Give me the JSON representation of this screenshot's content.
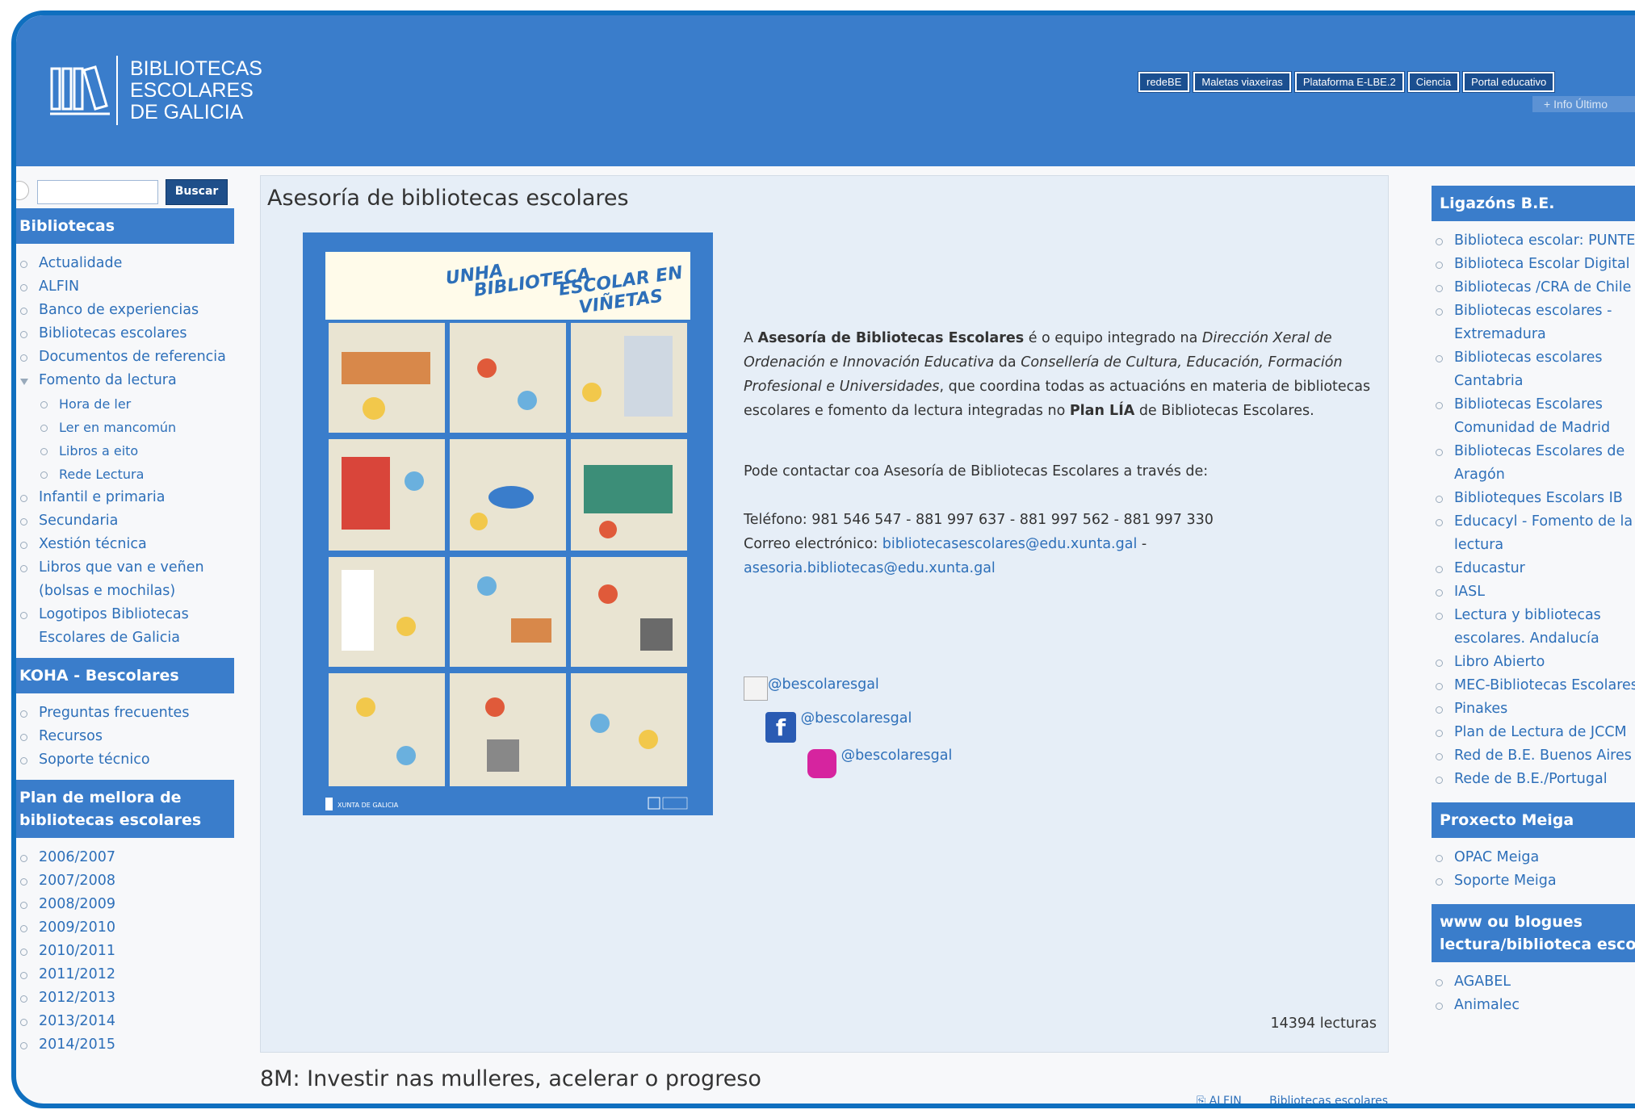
{
  "header": {
    "logo_text_1": "BIBLIOTECAS",
    "logo_text_2": "ESCOLARES",
    "logo_text_3": "DE GALICIA",
    "top_links": [
      "redeBE",
      "Maletas viaxeiras",
      "Plataforma E-LBE.2",
      "Ciencia",
      "Portal educativo"
    ],
    "info_strip": "+ Info   Último"
  },
  "search": {
    "button": "Buscar",
    "placeholder": ""
  },
  "left": {
    "bibliotecas_title": "Bibliotecas",
    "bibliotecas_items": [
      "Actualidade",
      "ALFIN",
      "Banco de experiencias",
      "Bibliotecas escolares",
      "Documentos de referencia"
    ],
    "fomento": "Fomento da lectura",
    "fomento_sub": [
      "Hora de ler",
      "Ler en mancomún",
      "Libros a eito",
      "Rede Lectura"
    ],
    "after_items": [
      "Infantil e primaria",
      "Secundaria",
      "Xestión técnica",
      "Libros que van e veñen (bolsas e mochilas)",
      "Logotipos Bibliotecas Escolares de Galicia"
    ],
    "koha_title": "KOHA - Bescolares",
    "koha_items": [
      "Preguntas frecuentes",
      "Recursos",
      "Soporte técnico"
    ],
    "plan_title": "Plan de mellora de bibliotecas escolares",
    "plan_items": [
      "2006/2007",
      "2007/2008",
      "2008/2009",
      "2009/2010",
      "2010/2011",
      "2011/2012",
      "2012/2013",
      "2013/2014",
      "2014/2015"
    ]
  },
  "content": {
    "title": "Asesoría de bibliotecas escolares",
    "poster_title_1": "UNHA",
    "poster_title_2": "BIBLIOTECA",
    "poster_title_3": "ESCOLAR EN",
    "poster_title_4": "VIÑETAS",
    "poster_footer_left": "XUNTA DE GALICIA",
    "p1_a": "A ",
    "p1_b": "Asesoría de Bibliotecas Escolares",
    "p1_c": " é o equipo integrado na ",
    "p1_d": "Dirección Xeral de Ordenación e Innovación Educativa",
    "p1_e": " da ",
    "p1_f": "Consellería de Cultura, Educación, Formación Profesional e Universidades",
    "p1_g": ", que coordina todas as actuacións en materia de bibliotecas escolares e fomento da lectura integradas no ",
    "p1_h": "Plan LÍA",
    "p1_i": " de Bibliotecas Escolares.",
    "p2": "Pode contactar coa Asesoría de Bibliotecas Escolares a través de:",
    "phone": "Teléfono: 981 546 547 - 881 997 637 - 881 997 562 - 881 997 330",
    "email_label": "Correo electrónico: ",
    "email1": "bibliotecasescolares@edu.xunta.gal",
    "email_sep": " -",
    "email2": "asesoria.bibliotecas@edu.xunta.gal",
    "social_twitter": "@bescolaresgal",
    "social_facebook": "@bescolaresgal",
    "social_instagram": "@bescolaresgal",
    "reads": "14394 lecturas"
  },
  "next": {
    "title": "8M: Investir nas mulleres, acelerar o progreso",
    "tag1": "ALFIN",
    "tag2": "Bibliotecas escolares"
  },
  "right": {
    "ligazons_title": "Ligazóns B.E.",
    "ligazons_items": [
      "Biblioteca escolar: PUNTEDU",
      "Biblioteca Escolar Digital",
      "Bibliotecas /CRA de Chile",
      "Bibliotecas escolares - Extremadura",
      "Bibliotecas escolares Cantabria",
      "Bibliotecas Escolares Comunidad de Madrid",
      "Bibliotecas Escolares de Aragón",
      "Biblioteques Escolars IB",
      "Educacyl - Fomento de la lectura",
      "Educastur",
      "IASL",
      "Lectura y bibliotecas escolares. Andalucía",
      "Libro Abierto",
      "MEC-Bibliotecas Escolares",
      "Pinakes",
      "Plan de Lectura de JCCM",
      "Red de B.E. Buenos Aires",
      "Rede de B.E./Portugal"
    ],
    "meiga_title": "Proxecto Meiga",
    "meiga_items": [
      "OPAC Meiga",
      "Soporte Meiga"
    ],
    "www_title": "www ou blogues lectura/biblioteca escolar",
    "www_items": [
      "AGABEL",
      "Animalec"
    ]
  },
  "colors": {
    "header": "#3a7dcb",
    "block": "#3a7dcb",
    "link": "#2d6fb9",
    "content_bg": "#e6eef7"
  }
}
